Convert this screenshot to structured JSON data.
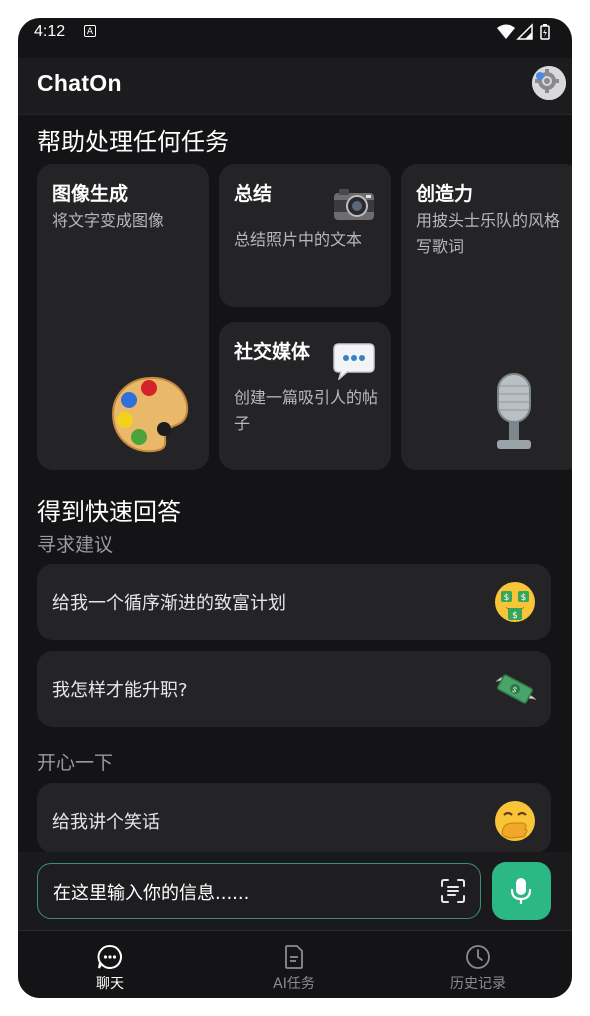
{
  "status_bar": {
    "time": "4:12",
    "a_indicator": "A"
  },
  "app_bar": {
    "title": "ChatOn",
    "settings_icon": "gear-badge-icon"
  },
  "tasks_section": {
    "heading": "帮助处理任何任务",
    "cards": [
      {
        "title": "图像生成",
        "desc": "将文字变成图像",
        "icon": "palette-icon"
      },
      {
        "title": "总结",
        "desc": "总结照片中的文本",
        "icon": "camera-icon"
      },
      {
        "title": "创造力",
        "desc": "用披头士乐队的风格写歌词",
        "icon": "microphone-icon"
      },
      {
        "title": "社交媒体",
        "desc": "创建一篇吸引人的帖子",
        "icon": "speech-bubble-icon"
      }
    ]
  },
  "quick_answers": {
    "heading": "得到快速回答",
    "groups": [
      {
        "label": "寻求建议",
        "items": [
          {
            "text": "给我一个循序渐进的致富计划",
            "icon": "money-mouth-face-icon"
          },
          {
            "text": "我怎样才能升职?",
            "icon": "money-with-wings-icon"
          }
        ]
      },
      {
        "label": "开心一下",
        "items": [
          {
            "text": "给我讲个笑话",
            "icon": "hand-over-mouth-face-icon"
          }
        ]
      }
    ]
  },
  "input": {
    "placeholder": "在这里输入你的信息......"
  },
  "bottom_nav": {
    "tabs": [
      {
        "label": "聊天",
        "active": true
      },
      {
        "label": "AI任务",
        "active": false
      },
      {
        "label": "历史记录",
        "active": false
      }
    ]
  },
  "colors": {
    "background": "#141416",
    "card": "#242426",
    "accent": "#2cb886"
  }
}
